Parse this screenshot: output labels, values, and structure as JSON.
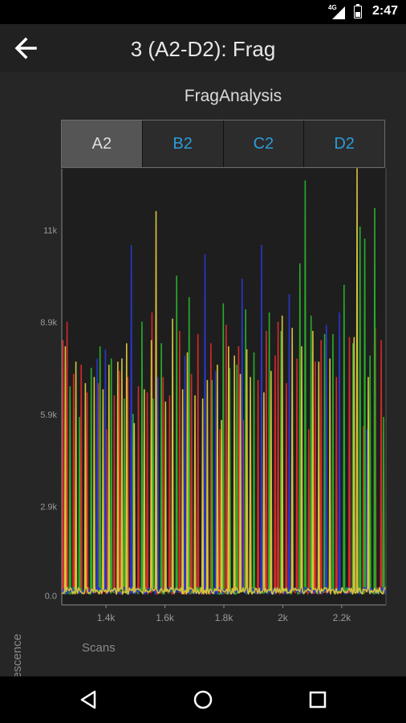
{
  "status_bar": {
    "network": "4G",
    "time": "2:47"
  },
  "app_bar": {
    "title": "3 (A2-D2): Frag",
    "back_icon": "arrow-left-icon"
  },
  "chart_title": "FragAnalysis",
  "tabs": [
    {
      "label": "A2",
      "selected": true
    },
    {
      "label": "B2",
      "selected": false
    },
    {
      "label": "C2",
      "selected": false
    },
    {
      "label": "D2",
      "selected": false
    }
  ],
  "colors": {
    "tab_active_text": "#dedede",
    "tab_inactive_text": "#2b9cd8",
    "background": "#262626"
  },
  "chart_data": {
    "type": "line",
    "xlabel": "Scans",
    "ylabel": "Fluorescence",
    "xlim": [
      1250,
      2350
    ],
    "ylim": [
      -300,
      13900
    ],
    "x_ticks": [
      1400,
      1600,
      1800,
      2000,
      2200
    ],
    "x_tick_labels": [
      "1.4k",
      "1.6k",
      "1.8k",
      "2k",
      "2.2k"
    ],
    "y_ticks": [
      0,
      2900,
      5900,
      8900,
      11900
    ],
    "y_tick_labels": [
      "0.0",
      "2.9k",
      "5.9k",
      "8.9k",
      "11k"
    ],
    "grid": false,
    "series": [
      {
        "color": "#d42a2a",
        "peaks": [
          [
            1254,
            8300
          ],
          [
            1268,
            8900
          ],
          [
            1290,
            7200
          ],
          [
            1316,
            7500
          ],
          [
            1336,
            6600
          ],
          [
            1374,
            6900
          ],
          [
            1402,
            5400
          ],
          [
            1428,
            6500
          ],
          [
            1446,
            7300
          ],
          [
            1474,
            7100
          ],
          [
            1510,
            6800
          ],
          [
            1540,
            6600
          ],
          [
            1556,
            9200
          ],
          [
            1594,
            7100
          ],
          [
            1616,
            6500
          ],
          [
            1650,
            8600
          ],
          [
            1690,
            7200
          ],
          [
            1712,
            8500
          ],
          [
            1756,
            8200
          ],
          [
            1786,
            5400
          ],
          [
            1808,
            8800
          ],
          [
            1850,
            8100
          ],
          [
            1866,
            5700
          ],
          [
            1916,
            7000
          ],
          [
            1944,
            8600
          ],
          [
            1974,
            7800
          ],
          [
            1984,
            8900
          ],
          [
            2012,
            6900
          ],
          [
            2048,
            7700
          ],
          [
            2088,
            5400
          ],
          [
            2110,
            7600
          ],
          [
            2130,
            8300
          ],
          [
            2182,
            7100
          ],
          [
            2226,
            8400
          ],
          [
            2274,
            5500
          ],
          [
            2314,
            8700
          ],
          [
            2334,
            8300
          ]
        ]
      },
      {
        "color": "#2aab2a",
        "peaks": [
          [
            1278,
            6800
          ],
          [
            1310,
            5800
          ],
          [
            1350,
            7400
          ],
          [
            1380,
            8100
          ],
          [
            1418,
            7700
          ],
          [
            1462,
            6400
          ],
          [
            1492,
            5900
          ],
          [
            1522,
            8900
          ],
          [
            1560,
            6400
          ],
          [
            1588,
            8200
          ],
          [
            1640,
            10400
          ],
          [
            1682,
            9700
          ],
          [
            1760,
            7000
          ],
          [
            1798,
            9500
          ],
          [
            1820,
            7400
          ],
          [
            1844,
            7500
          ],
          [
            1874,
            9300
          ],
          [
            1902,
            7900
          ],
          [
            1954,
            9200
          ],
          [
            1994,
            8600
          ],
          [
            2058,
            10800
          ],
          [
            2076,
            13500
          ],
          [
            2096,
            9100
          ],
          [
            2142,
            8500
          ],
          [
            2170,
            8500
          ],
          [
            2208,
            10100
          ],
          [
            2238,
            8200
          ],
          [
            2262,
            12000
          ],
          [
            2278,
            11600
          ],
          [
            2296,
            7800
          ],
          [
            2312,
            12600
          ],
          [
            2342,
            5800
          ]
        ]
      },
      {
        "color": "#2a36c8",
        "peaks": [
          [
            1370,
            7700
          ],
          [
            1398,
            8000
          ],
          [
            1486,
            11400
          ],
          [
            1576,
            7100
          ],
          [
            1668,
            7800
          ],
          [
            1736,
            11100
          ],
          [
            1772,
            7300
          ],
          [
            1862,
            10300
          ],
          [
            1928,
            11400
          ],
          [
            2022,
            9800
          ],
          [
            2148,
            8800
          ],
          [
            2192,
            9200
          ],
          [
            2286,
            5400
          ]
        ]
      },
      {
        "color": "#d6c23c",
        "peaks": [
          [
            1262,
            8100
          ],
          [
            1298,
            7600
          ],
          [
            1330,
            6900
          ],
          [
            1360,
            7100
          ],
          [
            1390,
            6700
          ],
          [
            1410,
            7500
          ],
          [
            1440,
            7600
          ],
          [
            1454,
            7700
          ],
          [
            1470,
            8200
          ],
          [
            1496,
            5600
          ],
          [
            1530,
            6700
          ],
          [
            1554,
            8300
          ],
          [
            1570,
            12500
          ],
          [
            1602,
            6300
          ],
          [
            1626,
            9000
          ],
          [
            1660,
            6700
          ],
          [
            1676,
            7900
          ],
          [
            1702,
            6500
          ],
          [
            1728,
            6400
          ],
          [
            1744,
            7000
          ],
          [
            1778,
            7500
          ],
          [
            1792,
            5700
          ],
          [
            1816,
            8100
          ],
          [
            1836,
            7800
          ],
          [
            1856,
            7200
          ],
          [
            1878,
            8000
          ],
          [
            1890,
            7100
          ],
          [
            1936,
            6600
          ],
          [
            1960,
            7300
          ],
          [
            1998,
            9100
          ],
          [
            2032,
            8700
          ],
          [
            2064,
            8100
          ],
          [
            2102,
            8600
          ],
          [
            2122,
            7600
          ],
          [
            2160,
            7700
          ],
          [
            2242,
            8400
          ],
          [
            2252,
            14700
          ],
          [
            2290,
            7100
          ]
        ]
      }
    ]
  },
  "nav_bar": {
    "back_icon": "nav-back-icon",
    "home_icon": "nav-home-icon",
    "recents_icon": "nav-recents-icon"
  }
}
